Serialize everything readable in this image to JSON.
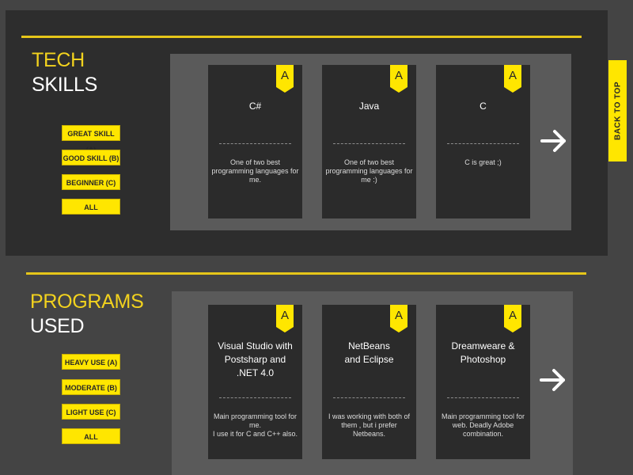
{
  "back_to_top": {
    "label": "BACK TO TOP"
  },
  "tech_skills": {
    "title_line1": "TECH",
    "title_line2": "SKILLS",
    "filters": [
      "GREAT SKILL (A)",
      "GOOD SKILL (B)",
      "BEGINNER (C)",
      "ALL"
    ],
    "cards": [
      {
        "grade": "A",
        "title": "C#",
        "description": "One of two best programming languages for me."
      },
      {
        "grade": "A",
        "title": "Java",
        "description": "One of two best programming languages for me :)"
      },
      {
        "grade": "A",
        "title": "C",
        "description": "C is great ;)"
      }
    ],
    "separator": "------------------------------"
  },
  "programs_used": {
    "title_line1": "PROGRAMS",
    "title_line2": "USED",
    "filters": [
      "HEAVY USE (A)",
      "MODERATE (B)",
      "LIGHT USE (C)",
      "ALL"
    ],
    "cards": [
      {
        "grade": "A",
        "title": "Visual Studio with Postsharp and .NET 4.0",
        "description": "Main programming tool for me.\nI use it for C and C++ also."
      },
      {
        "grade": "A",
        "title": "NetBeans\nand Eclipse",
        "description": "I was working with both of them , but i prefer Netbeans."
      },
      {
        "grade": "A",
        "title": "Dreamweare & Photoshop",
        "description": "Main programming tool for web. Deadly Adobe combination."
      }
    ],
    "separator": "------------------------------"
  },
  "colors": {
    "accent": "#ffe600",
    "section_dark": "#2d2d2d",
    "panel": "#5a5a5a",
    "card": "#2b2b2b"
  },
  "icons": {
    "next": "arrow-right-icon",
    "grade": "bookmark-badge-icon"
  }
}
